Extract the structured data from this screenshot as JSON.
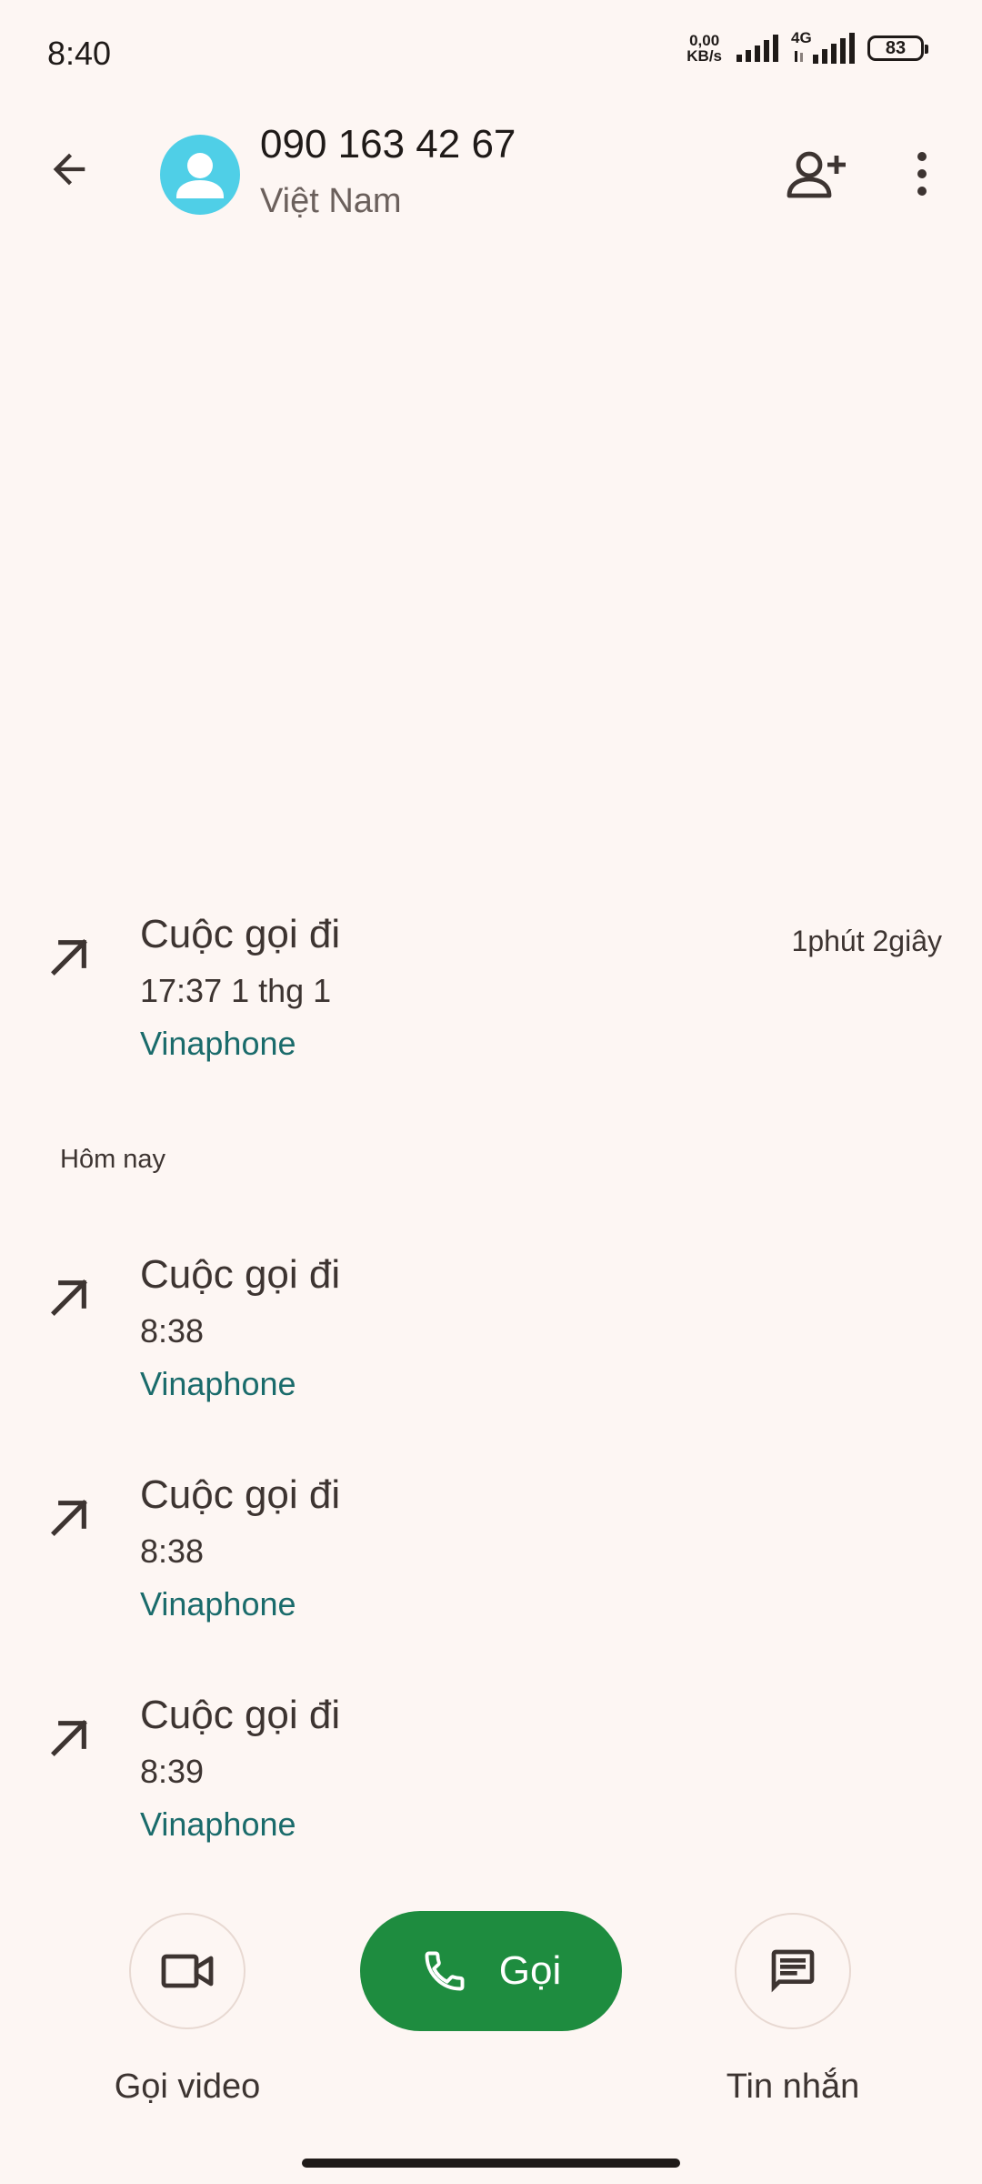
{
  "status_bar": {
    "time": "8:40",
    "net_speed_value": "0,00",
    "net_speed_unit": "KB/s",
    "network_type": "4G",
    "battery": "83"
  },
  "header": {
    "contact_number": "090 163 42 67",
    "contact_region": "Việt Nam"
  },
  "calls": [
    {
      "type": "Cuộc gọi đi",
      "time": "17:37 1 thg 1",
      "carrier": "Vinaphone",
      "duration": "1phút 2giây"
    },
    {
      "type": "Cuộc gọi đi",
      "time": "8:38",
      "carrier": "Vinaphone"
    },
    {
      "type": "Cuộc gọi đi",
      "time": "8:38",
      "carrier": "Vinaphone"
    },
    {
      "type": "Cuộc gọi đi",
      "time": "8:39",
      "carrier": "Vinaphone"
    }
  ],
  "section_today": "Hôm nay",
  "actions": {
    "video_label": "Gọi video",
    "call_label": "Gọi",
    "message_label": "Tin nhắn"
  },
  "colors": {
    "background": "#fdf6f3",
    "call_button": "#1e8c3f",
    "carrier_text": "#1a6b6b",
    "avatar": "#4fcfe7"
  },
  "icons": {
    "back": "arrow-left-icon",
    "add_contact": "person-add-icon",
    "more": "more-vert-icon",
    "outgoing": "call-made-icon",
    "video": "videocam-icon",
    "phone": "phone-icon",
    "message": "message-icon"
  }
}
